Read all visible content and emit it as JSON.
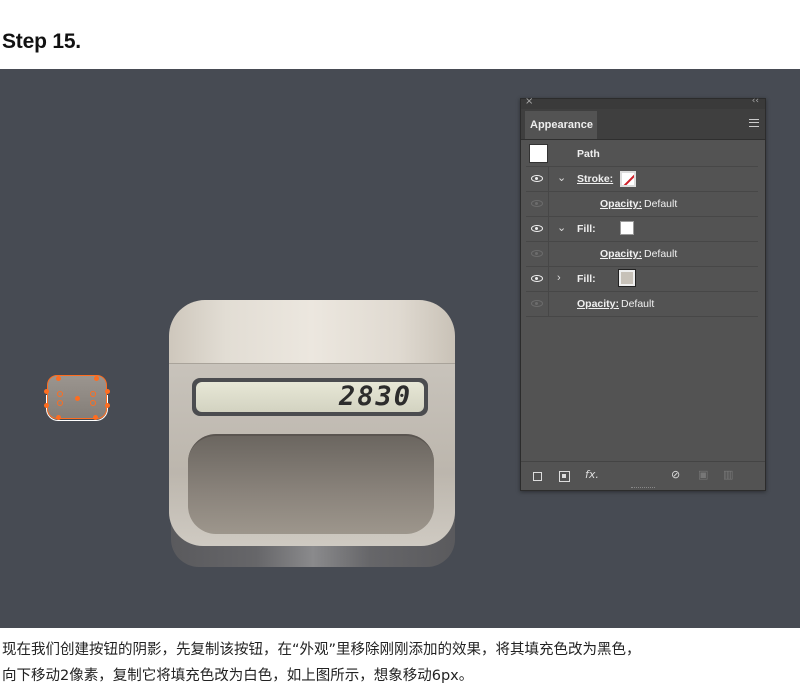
{
  "heading": "Step 15.",
  "artboard": {
    "display_value": "2830",
    "colors": {
      "canvas_bg": "#474b53",
      "selection": "#ff6d1f"
    }
  },
  "panel": {
    "close_glyph": "×",
    "collapse_glyph": "‹‹",
    "tab_label": "Appearance",
    "rows": {
      "path_label": "Path",
      "stroke_label": "Stroke:",
      "stroke_opacity_label": "Opacity:",
      "stroke_opacity_value": "Default",
      "fill1_label": "Fill:",
      "fill1_opacity_label": "Opacity:",
      "fill1_opacity_value": "Default",
      "fill2_label": "Fill:",
      "opacity_label": "Opacity:",
      "opacity_value": "Default"
    },
    "bottom": {
      "fx_label": "fx."
    }
  },
  "caption": {
    "line1": "现在我们创建按钮的阴影，先复制该按钮，在“外观”里移除刚刚添加的效果，将其填充色改为黑色，",
    "line2": "向下移动2像素，复制它将填充色改为白色，如上图所示，想象移动6px。"
  }
}
